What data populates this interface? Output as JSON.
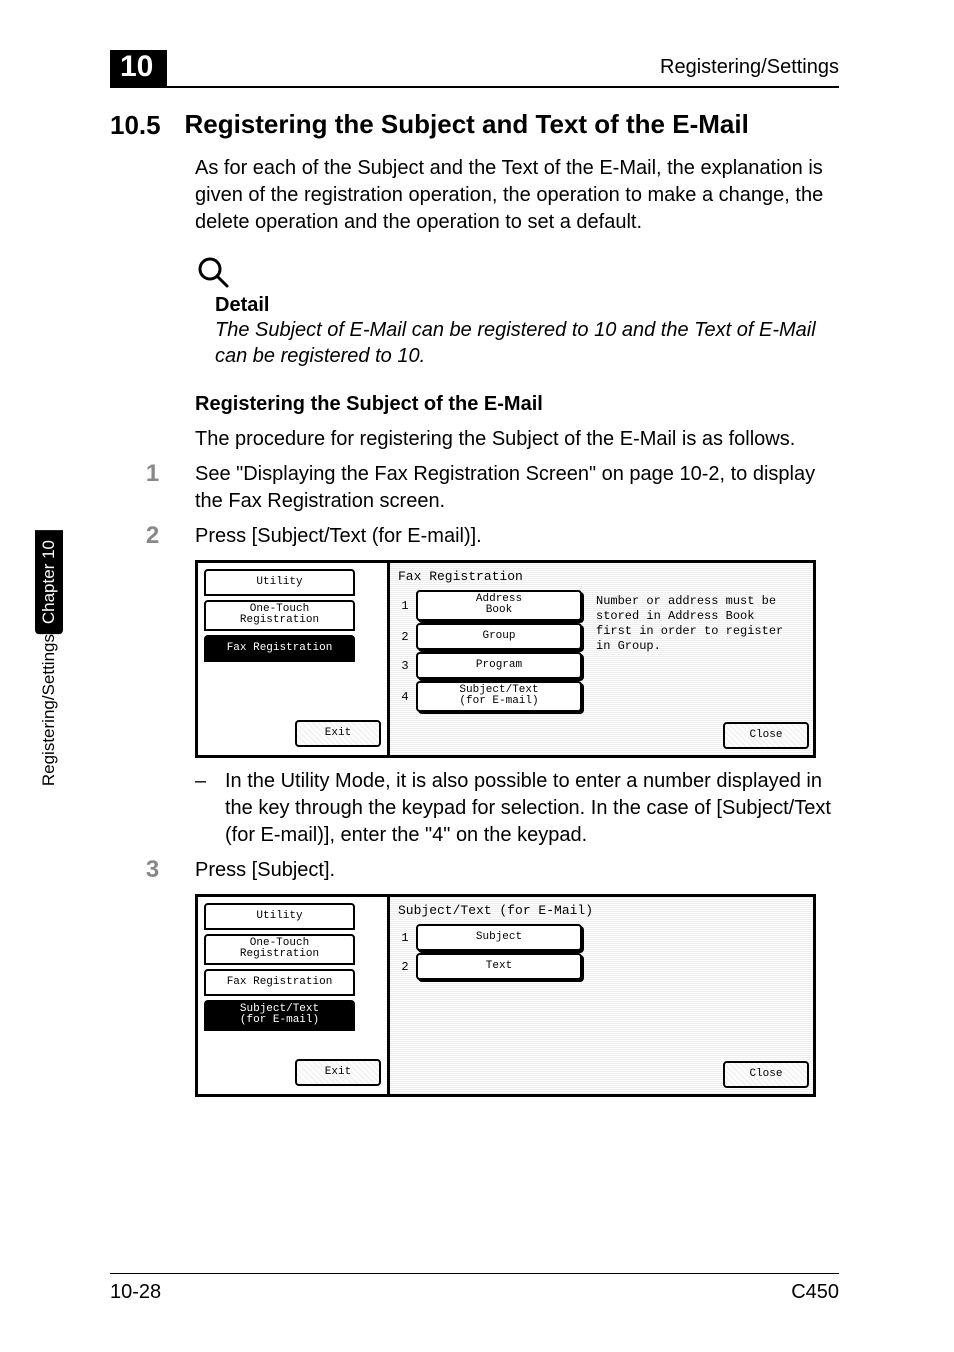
{
  "header": {
    "chapter_num": "10",
    "right": "Registering/Settings"
  },
  "section": {
    "number": "10.5",
    "title": "Registering the Subject and Text of the E-Mail",
    "intro": "As for each of the Subject and the Text of the E-Mail, the explanation is given of the registration operation, the operation to make a change, the delete operation and the operation to set a default."
  },
  "detail": {
    "label": "Detail",
    "text": "The Subject of E-Mail can be registered to 10 and the Text of E-Mail can be registered to 10."
  },
  "subhead": "Registering the Subject of the E-Mail",
  "sub_intro": "The procedure for registering the Subject of the E-Mail is as follows.",
  "steps": {
    "s1": {
      "num": "1",
      "text": "See \"Displaying the Fax Registration Screen\" on page 10-2, to display the Fax Registration screen."
    },
    "s2": {
      "num": "2",
      "text": "Press [Subject/Text (for E-mail)]."
    },
    "s3": {
      "num": "3",
      "text": "Press [Subject]."
    }
  },
  "bullet_after_lcd1": "In the Utility Mode, it is also possible to enter a number displayed in the key through the keypad for selection. In the case of [Subject/Text (for E-mail)], enter the \"4\" on the keypad.",
  "lcd1": {
    "title": "Fax Registration",
    "left": {
      "utility": "Utility",
      "one_touch_line1": "One-Touch",
      "one_touch_line2": "Registration",
      "fax_reg": "Fax Registration",
      "exit": "Exit"
    },
    "items": [
      {
        "idx": "1",
        "line1": "Address",
        "line2": "Book"
      },
      {
        "idx": "2",
        "line1": "Group"
      },
      {
        "idx": "3",
        "line1": "Program"
      },
      {
        "idx": "4",
        "line1": "Subject/Text",
        "line2": "(for E-mail)"
      }
    ],
    "hint": "Number or address must be stored in Address Book first in order to register in Group.",
    "close": "Close"
  },
  "lcd2": {
    "title": "Subject/Text (for E-Mail)",
    "left": {
      "utility": "Utility",
      "one_touch_line1": "One-Touch",
      "one_touch_line2": "Registration",
      "fax_reg": "Fax Registration",
      "subj_text_line1": "Subject/Text",
      "subj_text_line2": "(for E-mail)",
      "exit": "Exit"
    },
    "items": [
      {
        "idx": "1",
        "line1": "Subject"
      },
      {
        "idx": "2",
        "line1": "Text"
      }
    ],
    "close": "Close"
  },
  "sidebar": {
    "top": "Chapter 10",
    "bottom": "Registering/Settings"
  },
  "footer": {
    "left": "10-28",
    "right": "C450"
  }
}
